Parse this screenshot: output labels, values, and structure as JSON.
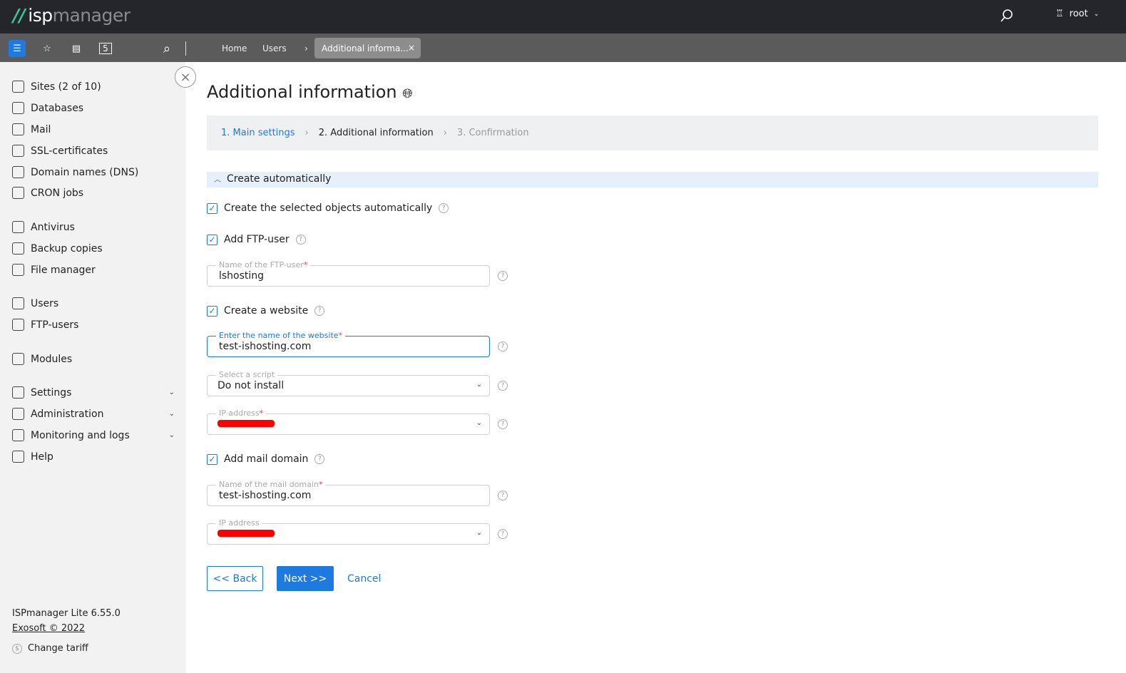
{
  "app": {
    "logo_isp": "isp",
    "logo_manager": "manager",
    "user": "root"
  },
  "toolbar": {
    "badge": "5",
    "breadcrumbs": [
      "Home",
      "Users"
    ],
    "tab": "Additional informa..."
  },
  "sidebar": {
    "items": [
      {
        "label": "Sites (2 of 10)",
        "icon": "sites-icon"
      },
      {
        "label": "Databases",
        "icon": "database-icon"
      },
      {
        "label": "Mail",
        "icon": "mail-icon"
      },
      {
        "label": "SSL-certificates",
        "icon": "lock-icon"
      },
      {
        "label": "Domain names (DNS)",
        "icon": "globe-icon"
      },
      {
        "label": "CRON jobs",
        "icon": "calendar-icon"
      },
      {
        "label": "Antivirus",
        "icon": "shield-icon"
      },
      {
        "label": "Backup copies",
        "icon": "backup-icon"
      },
      {
        "label": "File manager",
        "icon": "folder-icon"
      },
      {
        "label": "Users",
        "icon": "user-icon"
      },
      {
        "label": "FTP-users",
        "icon": "ftp-icon"
      },
      {
        "label": "Modules",
        "icon": "puzzle-icon"
      },
      {
        "label": "Settings",
        "icon": "settings-icon"
      },
      {
        "label": "Administration",
        "icon": "admin-icon"
      },
      {
        "label": "Monitoring and logs",
        "icon": "monitor-icon"
      },
      {
        "label": "Help",
        "icon": "help-icon"
      }
    ],
    "version": "ISPmanager Lite 6.55.0",
    "copyright": "Exosoft © 2022",
    "tariff": "Change tariff"
  },
  "page": {
    "title": "Additional information",
    "steps": [
      "1. Main settings",
      "2. Additional information",
      "3. Confirmation"
    ],
    "section": "Create automatically",
    "cb_auto": "Create the selected objects automatically",
    "cb_ftp": "Add FTP-user",
    "ftp_label": "Name of the FTP-user",
    "ftp_value": "lshosting",
    "cb_site": "Create a website",
    "site_label": "Enter the name of the website",
    "site_value": "test-ishosting.com",
    "script_label": "Select a script",
    "script_value": "Do not install",
    "ip_label": "IP address",
    "cb_mail": "Add mail domain",
    "mail_label": "Name of the mail domain",
    "mail_value": "test-ishosting.com",
    "ip2_label": "IP address",
    "back": "<< Back",
    "next": "Next >>",
    "cancel": "Cancel"
  }
}
